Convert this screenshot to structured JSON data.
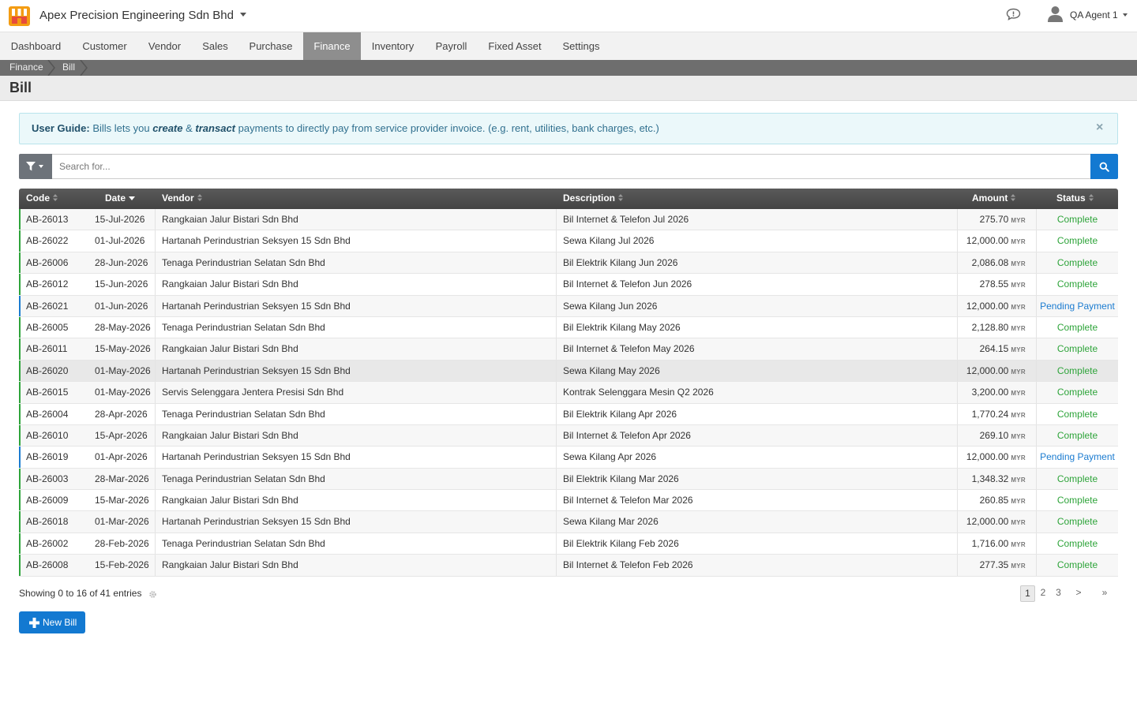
{
  "app": {
    "company": "Apex Precision Engineering Sdn Bhd",
    "user": "QA Agent 1"
  },
  "nav": {
    "items": [
      {
        "label": "Dashboard"
      },
      {
        "label": "Customer"
      },
      {
        "label": "Vendor"
      },
      {
        "label": "Sales"
      },
      {
        "label": "Purchase"
      },
      {
        "label": "Finance",
        "active": true
      },
      {
        "label": "Inventory"
      },
      {
        "label": "Payroll"
      },
      {
        "label": "Fixed Asset"
      },
      {
        "label": "Settings"
      }
    ]
  },
  "breadcrumb": [
    "Finance",
    "Bill"
  ],
  "page": {
    "title": "Bill"
  },
  "guide": {
    "label": "User Guide:",
    "text1": "Bills lets you",
    "em1": "create",
    "amp": "&",
    "em2": "transact",
    "text2": "payments to directly pay from service provider invoice. (e.g. rent, utilities, bank charges, etc.)",
    "close": "×"
  },
  "search": {
    "placeholder": "Search for..."
  },
  "table": {
    "columns": [
      "Code",
      "Date",
      "Vendor",
      "Description",
      "Amount",
      "Status"
    ],
    "currency": "MYR",
    "rows": [
      {
        "code": "AB-26013",
        "date": "15-Jul-2026",
        "vendor": "Rangkaian Jalur Bistari Sdn Bhd",
        "description": "Bil Internet & Telefon Jul 2026",
        "amount": "275.70",
        "status": "Complete"
      },
      {
        "code": "AB-26022",
        "date": "01-Jul-2026",
        "vendor": "Hartanah Perindustrian Seksyen 15 Sdn Bhd",
        "description": "Sewa Kilang Jul 2026",
        "amount": "12,000.00",
        "status": "Complete"
      },
      {
        "code": "AB-26006",
        "date": "28-Jun-2026",
        "vendor": "Tenaga Perindustrian Selatan Sdn Bhd",
        "description": "Bil Elektrik Kilang Jun 2026",
        "amount": "2,086.08",
        "status": "Complete"
      },
      {
        "code": "AB-26012",
        "date": "15-Jun-2026",
        "vendor": "Rangkaian Jalur Bistari Sdn Bhd",
        "description": "Bil Internet & Telefon Jun 2026",
        "amount": "278.55",
        "status": "Complete"
      },
      {
        "code": "AB-26021",
        "date": "01-Jun-2026",
        "vendor": "Hartanah Perindustrian Seksyen 15 Sdn Bhd",
        "description": "Sewa Kilang Jun 2026",
        "amount": "12,000.00",
        "status": "Pending Payment"
      },
      {
        "code": "AB-26005",
        "date": "28-May-2026",
        "vendor": "Tenaga Perindustrian Selatan Sdn Bhd",
        "description": "Bil Elektrik Kilang May 2026",
        "amount": "2,128.80",
        "status": "Complete"
      },
      {
        "code": "AB-26011",
        "date": "15-May-2026",
        "vendor": "Rangkaian Jalur Bistari Sdn Bhd",
        "description": "Bil Internet & Telefon May 2026",
        "amount": "264.15",
        "status": "Complete"
      },
      {
        "code": "AB-26020",
        "date": "01-May-2026",
        "vendor": "Hartanah Perindustrian Seksyen 15 Sdn Bhd",
        "description": "Sewa Kilang May 2026",
        "amount": "12,000.00",
        "status": "Complete"
      },
      {
        "code": "AB-26015",
        "date": "01-May-2026",
        "vendor": "Servis Selenggara Jentera Presisi Sdn Bhd",
        "description": "Kontrak Selenggara Mesin Q2 2026",
        "amount": "3,200.00",
        "status": "Complete"
      },
      {
        "code": "AB-26004",
        "date": "28-Apr-2026",
        "vendor": "Tenaga Perindustrian Selatan Sdn Bhd",
        "description": "Bil Elektrik Kilang Apr 2026",
        "amount": "1,770.24",
        "status": "Complete"
      },
      {
        "code": "AB-26010",
        "date": "15-Apr-2026",
        "vendor": "Rangkaian Jalur Bistari Sdn Bhd",
        "description": "Bil Internet & Telefon Apr 2026",
        "amount": "269.10",
        "status": "Complete"
      },
      {
        "code": "AB-26019",
        "date": "01-Apr-2026",
        "vendor": "Hartanah Perindustrian Seksyen 15 Sdn Bhd",
        "description": "Sewa Kilang Apr 2026",
        "amount": "12,000.00",
        "status": "Pending Payment"
      },
      {
        "code": "AB-26003",
        "date": "28-Mar-2026",
        "vendor": "Tenaga Perindustrian Selatan Sdn Bhd",
        "description": "Bil Elektrik Kilang Mar 2026",
        "amount": "1,348.32",
        "status": "Complete"
      },
      {
        "code": "AB-26009",
        "date": "15-Mar-2026",
        "vendor": "Rangkaian Jalur Bistari Sdn Bhd",
        "description": "Bil Internet & Telefon Mar 2026",
        "amount": "260.85",
        "status": "Complete"
      },
      {
        "code": "AB-26018",
        "date": "01-Mar-2026",
        "vendor": "Hartanah Perindustrian Seksyen 15 Sdn Bhd",
        "description": "Sewa Kilang Mar 2026",
        "amount": "12,000.00",
        "status": "Complete"
      },
      {
        "code": "AB-26002",
        "date": "28-Feb-2026",
        "vendor": "Tenaga Perindustrian Selatan Sdn Bhd",
        "description": "Bil Elektrik Kilang Feb 2026",
        "amount": "1,716.00",
        "status": "Complete"
      },
      {
        "code": "AB-26008",
        "date": "15-Feb-2026",
        "vendor": "Rangkaian Jalur Bistari Sdn Bhd",
        "description": "Bil Internet & Telefon Feb 2026",
        "amount": "277.35",
        "status": "Complete"
      }
    ]
  },
  "footer": {
    "showing": "Showing 0 to 16 of 41 entries"
  },
  "pagination": [
    "1",
    "2",
    "3",
    ">",
    "»"
  ],
  "actions": {
    "new_bill": "New Bill"
  },
  "colors": {
    "complete": "#2ea43a",
    "pending": "#1a7bd0",
    "primary": "#1379d1",
    "nav_active": "#8e8e8e"
  }
}
